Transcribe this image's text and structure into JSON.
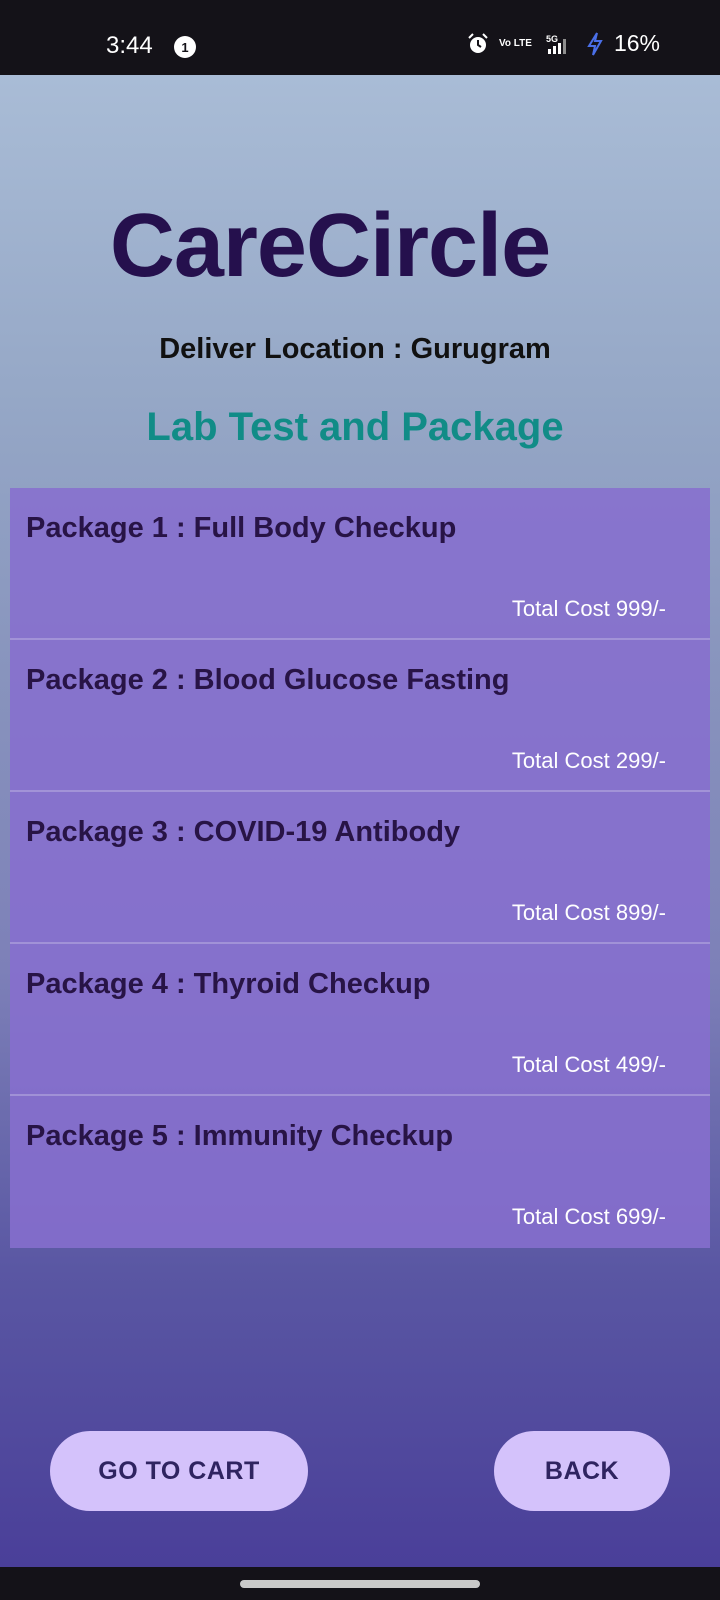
{
  "status_bar": {
    "time": "3:44",
    "notification_count": "1",
    "network_volte": "Vo LTE",
    "network_type": "5G",
    "battery": "16%"
  },
  "app": {
    "title": "CareCircle",
    "location": "Deliver Location : Gurugram",
    "section_title": "Lab Test and Package"
  },
  "packages": [
    {
      "name": "Package 1 : Full Body Checkup",
      "cost": "Total Cost 999/-"
    },
    {
      "name": "Package 2 : Blood Glucose Fasting",
      "cost": "Total Cost 299/-"
    },
    {
      "name": "Package 3 : COVID-19 Antibody",
      "cost": "Total Cost 899/-"
    },
    {
      "name": "Package 4 : Thyroid Checkup",
      "cost": "Total Cost 499/-"
    },
    {
      "name": "Package 5 : Immunity Checkup",
      "cost": "Total Cost 699/-"
    }
  ],
  "buttons": {
    "go_to_cart": "GO TO CART",
    "back": "BACK"
  },
  "colors": {
    "title": "#25104d",
    "section_title": "#118c87",
    "package_background": "#866ece",
    "button_background": "#d4c2fb"
  }
}
